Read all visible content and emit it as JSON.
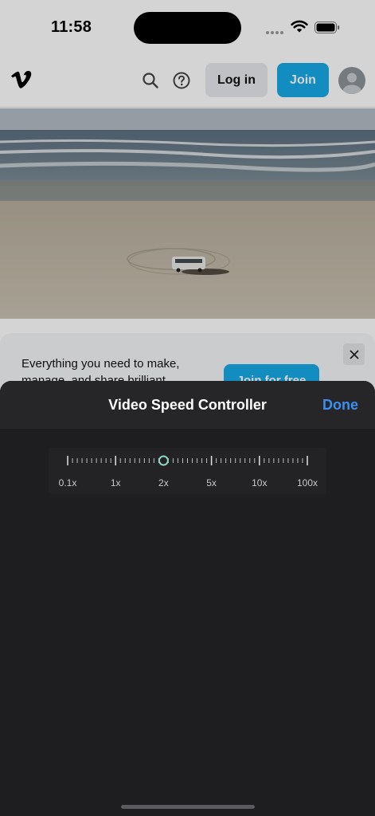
{
  "status_bar": {
    "time": "11:58"
  },
  "nav": {
    "login_label": "Log in",
    "join_label": "Join"
  },
  "promo": {
    "text": "Everything you need to make, manage, and share brilliant",
    "join_label": "Join for free"
  },
  "sheet": {
    "title": "Video Speed Controller",
    "done_label": "Done",
    "speed_labels": [
      "0.1x",
      "1x",
      "2x",
      "5x",
      "10x",
      "100x"
    ],
    "selected_speed": "2x"
  },
  "colors": {
    "accent": "#17a9e6",
    "done": "#3b8ff0",
    "sheet_background": "#1e1e20",
    "thumb": "#8fd3c5"
  }
}
